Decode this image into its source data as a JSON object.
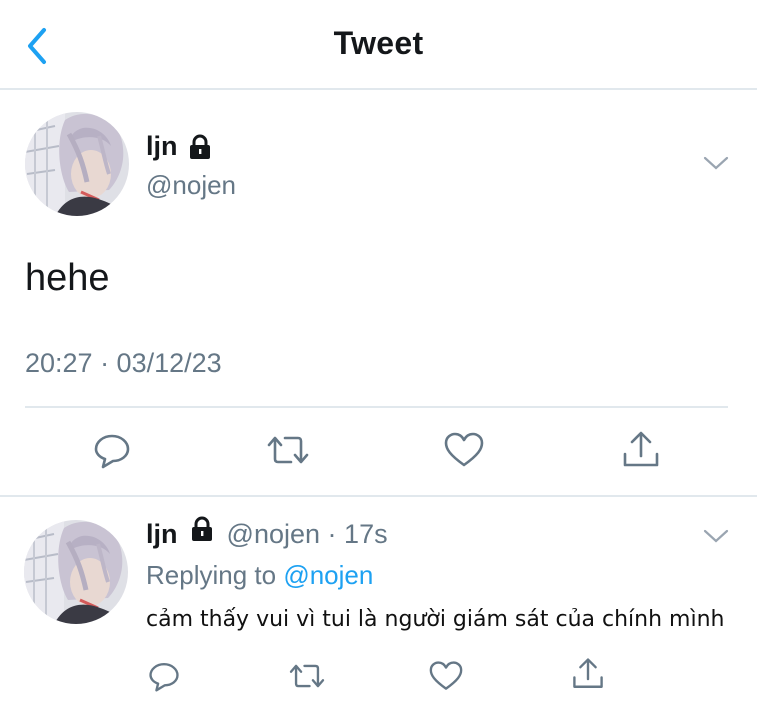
{
  "header": {
    "title": "Tweet"
  },
  "tweet": {
    "name": "ljn",
    "handle": "@nojen",
    "text": "hehe",
    "timestamp": "20:27 · 03/12/23"
  },
  "reply": {
    "name": "ljn",
    "handle": "@nojen",
    "separator": "·",
    "time": "17s",
    "replying_prefix": "Replying to",
    "replying_handle": "@nojen",
    "text": "cảm thấy vui vì tui là người giám sát của chính mình"
  },
  "icons": {
    "back": "chevron-left-icon",
    "lock": "lock-icon",
    "more": "chevron-down-icon",
    "reply": "comment-icon",
    "retweet": "retweet-icon",
    "like": "heart-icon",
    "share": "share-icon"
  },
  "colors": {
    "accent": "#1da1f2",
    "secondary": "#657786",
    "divider": "#e1e8ed"
  }
}
